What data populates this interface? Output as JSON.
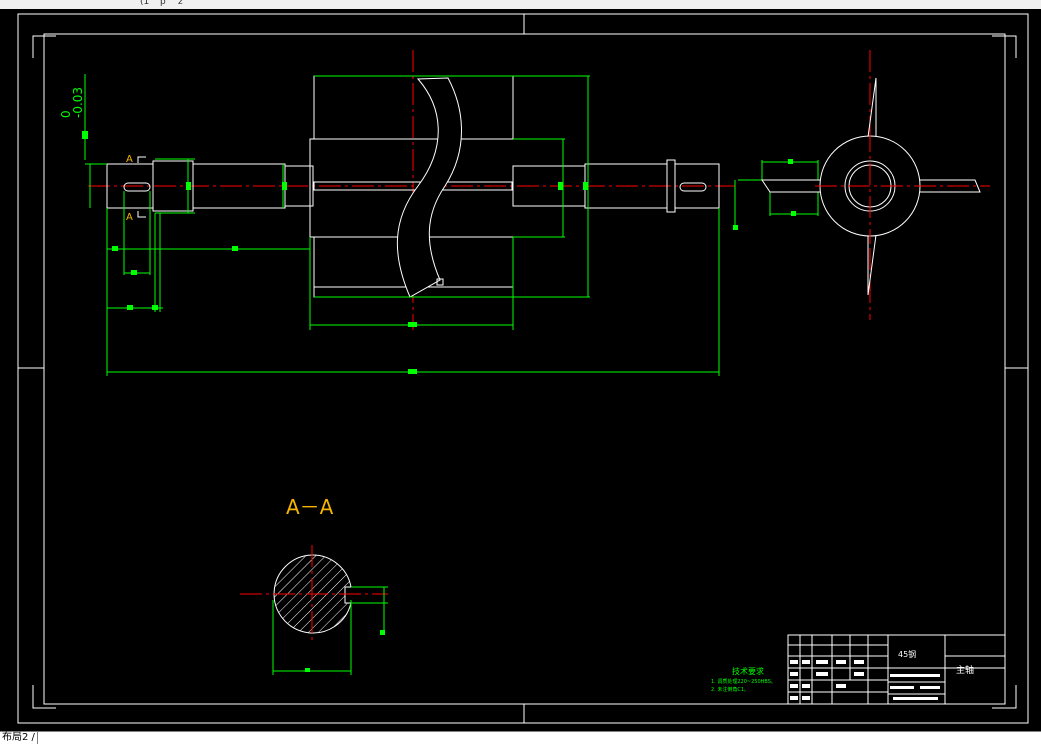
{
  "window": {
    "top_fragments": [
      "(1",
      "p",
      "ž"
    ],
    "tab_label": "布局2 /"
  },
  "colors": {
    "background": "#000000",
    "outline": "#ffffff",
    "dimension": "#00ff00",
    "centerline": "#ff0000",
    "section_label": "#f5b400"
  },
  "drawing": {
    "tolerance_upper": "0",
    "tolerance_lower": "-0.03",
    "section_mark_top": "A",
    "section_mark_bottom": "A",
    "section_title": "A－A",
    "notes_title": "技术要求",
    "notes_line1": "1. 调质处理220~250HBS。",
    "notes_line2": "2. 未注倒角C1。",
    "title_block": {
      "material": "45钢",
      "part_name": "主轴"
    }
  }
}
